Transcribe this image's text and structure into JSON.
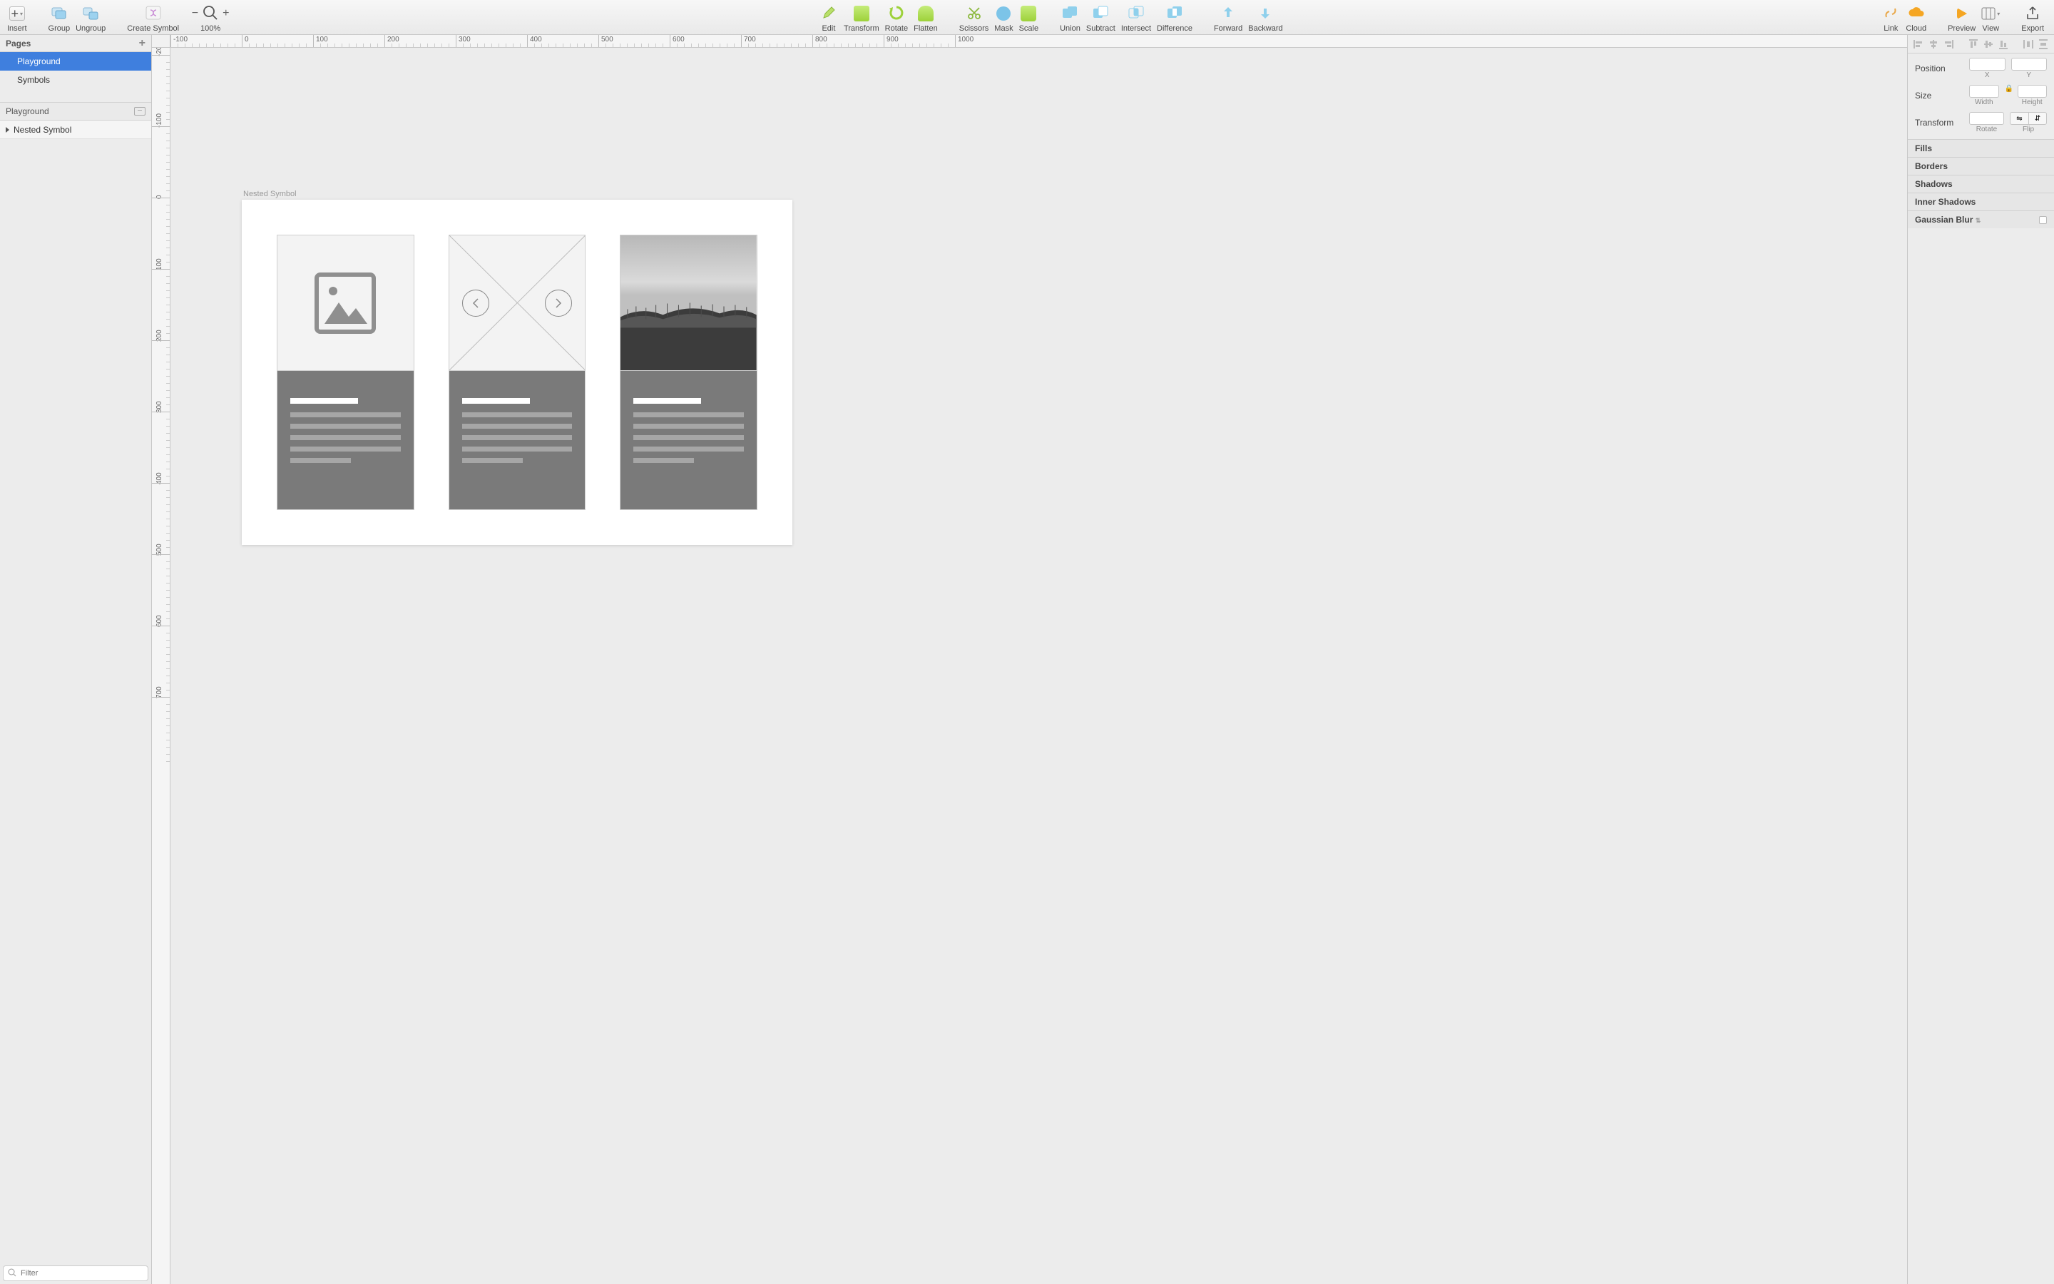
{
  "toolbar": {
    "insert": "Insert",
    "group": "Group",
    "ungroup": "Ungroup",
    "create_symbol": "Create Symbol",
    "zoom": "100%",
    "edit": "Edit",
    "transform": "Transform",
    "rotate": "Rotate",
    "flatten": "Flatten",
    "scissors": "Scissors",
    "mask": "Mask",
    "scale": "Scale",
    "union": "Union",
    "subtract": "Subtract",
    "intersect": "Intersect",
    "difference": "Difference",
    "forward": "Forward",
    "backward": "Backward",
    "link": "Link",
    "cloud": "Cloud",
    "preview": "Preview",
    "view": "View",
    "export": "Export"
  },
  "left": {
    "pages_header": "Pages",
    "pages": [
      {
        "name": "Playground",
        "selected": true
      },
      {
        "name": "Symbols",
        "selected": false
      }
    ],
    "layers_header": "Playground",
    "layers": [
      {
        "name": "Nested Symbol"
      }
    ],
    "filter_placeholder": "Filter"
  },
  "canvas": {
    "artboard_label": "Nested Symbol",
    "ruler_h_labels": [
      "0",
      "100",
      "200",
      "300",
      "400",
      "500",
      "600",
      "700",
      "800"
    ],
    "ruler_v_labels": [
      "-100",
      "0",
      "100",
      "200",
      "300",
      "400",
      "500",
      "600"
    ]
  },
  "right": {
    "position_label": "Position",
    "x_label": "X",
    "y_label": "Y",
    "size_label": "Size",
    "width_label": "Width",
    "height_label": "Height",
    "transform_label": "Transform",
    "rotate_label": "Rotate",
    "flip_label": "Flip",
    "sections": [
      "Fills",
      "Borders",
      "Shadows",
      "Inner Shadows",
      "Gaussian Blur"
    ]
  }
}
